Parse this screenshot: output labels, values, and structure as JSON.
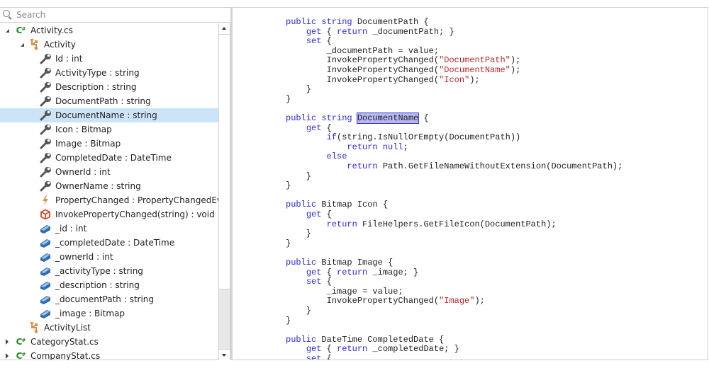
{
  "search": {
    "placeholder": "Search",
    "value": ""
  },
  "tree": {
    "rows": [
      {
        "label": "Activity.cs",
        "icon": "csharp-file-icon",
        "level": 0,
        "expander": "open"
      },
      {
        "label": "Activity",
        "icon": "class-icon",
        "level": 1,
        "expander": "open"
      },
      {
        "label": "Id : int",
        "icon": "property-wrench-icon",
        "level": 2
      },
      {
        "label": "ActivityType : string",
        "icon": "property-wrench-icon",
        "level": 2
      },
      {
        "label": "Description : string",
        "icon": "property-wrench-icon",
        "level": 2
      },
      {
        "label": "DocumentPath : string",
        "icon": "property-wrench-icon",
        "level": 2
      },
      {
        "label": "DocumentName : string",
        "icon": "property-wrench-icon",
        "level": 2,
        "selected": true
      },
      {
        "label": "Icon : Bitmap",
        "icon": "property-wrench-icon",
        "level": 2
      },
      {
        "label": "Image : Bitmap",
        "icon": "property-wrench-icon",
        "level": 2
      },
      {
        "label": "CompletedDate : DateTime",
        "icon": "property-wrench-icon",
        "level": 2
      },
      {
        "label": "OwnerId : int",
        "icon": "property-wrench-icon",
        "level": 2
      },
      {
        "label": "OwnerName : string",
        "icon": "property-wrench-icon",
        "level": 2
      },
      {
        "label": "PropertyChanged : PropertyChangedEventHandler",
        "icon": "event-lightning-icon",
        "level": 2
      },
      {
        "label": "InvokePropertyChanged(string) : void",
        "icon": "method-cube-icon",
        "level": 2
      },
      {
        "label": "_id : int",
        "icon": "field-icon",
        "level": 2
      },
      {
        "label": "_completedDate : DateTime",
        "icon": "field-icon",
        "level": 2
      },
      {
        "label": "_ownerId : int",
        "icon": "field-icon",
        "level": 2
      },
      {
        "label": "_activityType : string",
        "icon": "field-icon",
        "level": 2
      },
      {
        "label": "_description : string",
        "icon": "field-icon",
        "level": 2
      },
      {
        "label": "_documentPath : string",
        "icon": "field-icon",
        "level": 2
      },
      {
        "label": "_image : Bitmap",
        "icon": "field-icon",
        "level": 2
      },
      {
        "label": "ActivityList",
        "icon": "class-icon",
        "level": 1
      },
      {
        "label": "CategoryStat.cs",
        "icon": "csharp-file-icon",
        "level": 0,
        "expander": "closed"
      },
      {
        "label": "CompanyStat.cs",
        "icon": "csharp-file-icon",
        "level": 0,
        "expander": "closed"
      }
    ],
    "scroll": {
      "thumb_start": 0.0,
      "thumb_fraction": 0.81
    }
  },
  "colors": {
    "keyword": "#2a2ad6",
    "string": "#b52a2a",
    "selection_row": "#cce4f7",
    "highlight": "#b8b8f5",
    "csharp_icon": "#1f8a1f",
    "class_icon": "#d9904a",
    "field_icon": "#2f6db0",
    "method_icon": "#c9502a"
  },
  "code": {
    "lines": [
      [
        {
          "t": "public string",
          "c": "kw"
        },
        {
          "t": " DocumentPath {"
        }
      ],
      [
        {
          "t": "    "
        },
        {
          "t": "get",
          "c": "kw"
        },
        {
          "t": " { "
        },
        {
          "t": "return",
          "c": "kw"
        },
        {
          "t": " _documentPath; }"
        }
      ],
      [
        {
          "t": "    "
        },
        {
          "t": "set",
          "c": "kw"
        },
        {
          "t": " {"
        }
      ],
      [
        {
          "t": "        _documentPath = value;"
        }
      ],
      [
        {
          "t": "        InvokePropertyChanged("
        },
        {
          "t": "\"DocumentPath\"",
          "c": "str"
        },
        {
          "t": ");"
        }
      ],
      [
        {
          "t": "        InvokePropertyChanged("
        },
        {
          "t": "\"DocumentName\"",
          "c": "str"
        },
        {
          "t": ");"
        }
      ],
      [
        {
          "t": "        InvokePropertyChanged("
        },
        {
          "t": "\"Icon\"",
          "c": "str"
        },
        {
          "t": ");"
        }
      ],
      [
        {
          "t": "    }"
        }
      ],
      [
        {
          "t": "}"
        }
      ],
      [],
      [
        {
          "t": "public string",
          "c": "kw"
        },
        {
          "t": " "
        },
        {
          "t": "DocumentName",
          "c": "hl"
        },
        {
          "t": " {"
        }
      ],
      [
        {
          "t": "    "
        },
        {
          "t": "get",
          "c": "kw"
        },
        {
          "t": " {"
        }
      ],
      [
        {
          "t": "        "
        },
        {
          "t": "if",
          "c": "kw"
        },
        {
          "t": "(string.IsNullOrEmpty(DocumentPath))"
        }
      ],
      [
        {
          "t": "            "
        },
        {
          "t": "return null",
          "c": "kw"
        },
        {
          "t": ";"
        }
      ],
      [
        {
          "t": "        "
        },
        {
          "t": "else",
          "c": "kw"
        }
      ],
      [
        {
          "t": "            "
        },
        {
          "t": "return",
          "c": "kw"
        },
        {
          "t": " Path.GetFileNameWithoutExtension(DocumentPath);"
        }
      ],
      [
        {
          "t": "    }"
        }
      ],
      [
        {
          "t": "}"
        }
      ],
      [],
      [
        {
          "t": "public",
          "c": "kw"
        },
        {
          "t": " Bitmap Icon {"
        }
      ],
      [
        {
          "t": "    "
        },
        {
          "t": "get",
          "c": "kw"
        },
        {
          "t": " {"
        }
      ],
      [
        {
          "t": "        "
        },
        {
          "t": "return",
          "c": "kw"
        },
        {
          "t": " FileHelpers.GetFileIcon(DocumentPath);"
        }
      ],
      [
        {
          "t": "    }"
        }
      ],
      [
        {
          "t": "}"
        }
      ],
      [],
      [
        {
          "t": "public",
          "c": "kw"
        },
        {
          "t": " Bitmap Image {"
        }
      ],
      [
        {
          "t": "    "
        },
        {
          "t": "get",
          "c": "kw"
        },
        {
          "t": " { "
        },
        {
          "t": "return",
          "c": "kw"
        },
        {
          "t": " _image; }"
        }
      ],
      [
        {
          "t": "    "
        },
        {
          "t": "set",
          "c": "kw"
        },
        {
          "t": " {"
        }
      ],
      [
        {
          "t": "        _image = value;"
        }
      ],
      [
        {
          "t": "        InvokePropertyChanged("
        },
        {
          "t": "\"Image\"",
          "c": "str"
        },
        {
          "t": ");"
        }
      ],
      [
        {
          "t": "    }"
        }
      ],
      [
        {
          "t": "}"
        }
      ],
      [],
      [
        {
          "t": "public",
          "c": "kw"
        },
        {
          "t": " DateTime CompletedDate {"
        }
      ],
      [
        {
          "t": "    "
        },
        {
          "t": "get",
          "c": "kw"
        },
        {
          "t": " { "
        },
        {
          "t": "return",
          "c": "kw"
        },
        {
          "t": " _completedDate; }"
        }
      ],
      [
        {
          "t": "    "
        },
        {
          "t": "set",
          "c": "kw"
        },
        {
          "t": " {"
        }
      ]
    ]
  }
}
